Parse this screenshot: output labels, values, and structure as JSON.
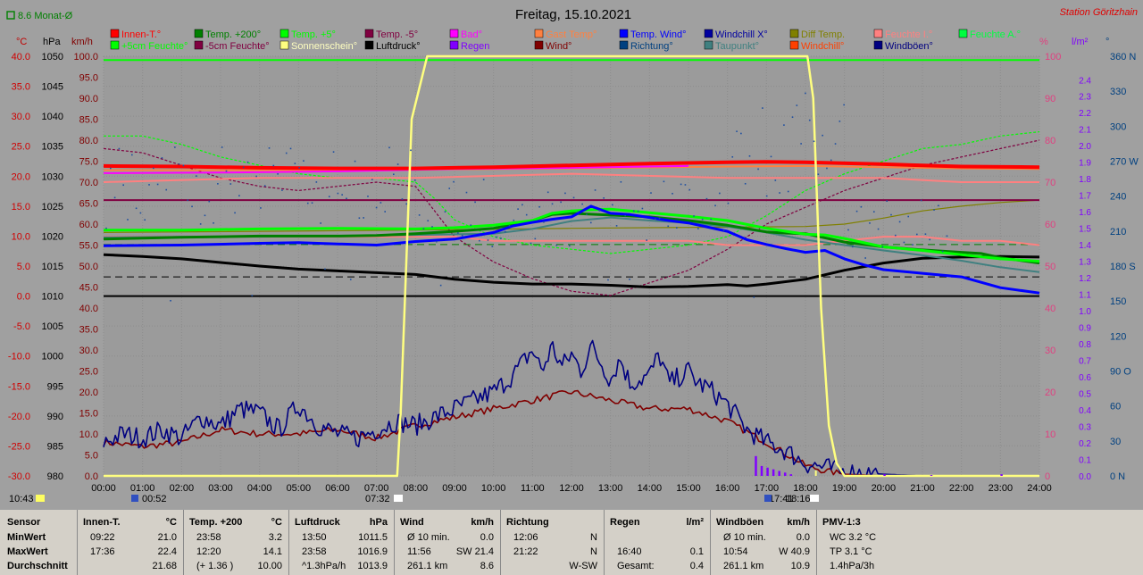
{
  "chart_data": {
    "type": "line",
    "title": "Freitag, 15.10.2021",
    "station": "Station Göritzhain",
    "month_avg_label": "8.6 Monat-Ø",
    "axis_units": {
      "temp": "°C",
      "press": "hPa",
      "kmh": "km/h",
      "pct": "%",
      "rain": "l/m²",
      "dir": "°"
    },
    "x_ticks": [
      "00:00",
      "01:00",
      "02:00",
      "03:00",
      "04:00",
      "05:00",
      "06:00",
      "07:00",
      "08:00",
      "09:00",
      "10:00",
      "11:00",
      "12:00",
      "13:00",
      "14:00",
      "15:00",
      "16:00",
      "17:00",
      "18:00",
      "19:00",
      "20:00",
      "21:00",
      "22:00",
      "23:00",
      "24:00"
    ],
    "temp_ticks": [
      "40.0",
      "35.0",
      "30.0",
      "25.0",
      "20.0",
      "15.0",
      "10.0",
      "5.0",
      "0.0",
      "-5.0",
      "-10.0",
      "-15.0",
      "-20.0",
      "-25.0",
      "-30.0"
    ],
    "press_ticks": [
      "1050",
      "1045",
      "1040",
      "1035",
      "1030",
      "1025",
      "1020",
      "1015",
      "1010",
      "1005",
      "1000",
      "995",
      "990",
      "985",
      "980"
    ],
    "kmh_ticks": [
      "100.0",
      "95.0",
      "90.0",
      "85.0",
      "80.0",
      "75.0",
      "70.0",
      "65.0",
      "60.0",
      "55.0",
      "50.0",
      "45.0",
      "40.0",
      "35.0",
      "30.0",
      "25.0",
      "20.0",
      "15.0",
      "10.0",
      "5.0",
      "0.0"
    ],
    "pct_ticks": [
      "100",
      "90",
      "80",
      "70",
      "60",
      "50",
      "40",
      "30",
      "20",
      "10",
      "0"
    ],
    "rain_ticks": [
      "2.4",
      "2.3",
      "2.2",
      "2.1",
      "2.0",
      "1.9",
      "1.8",
      "1.7",
      "1.6",
      "1.5",
      "1.4",
      "1.3",
      "1.2",
      "1.1",
      "1.0",
      "0.9",
      "0.8",
      "0.7",
      "0.6",
      "0.5",
      "0.4",
      "0.3",
      "0.2",
      "0.1",
      "0.0"
    ],
    "dir_ticks": [
      "360 N",
      "330",
      "300",
      "270 W",
      "240",
      "210",
      "180 S",
      "150",
      "120",
      "90 O",
      "60",
      "30",
      "0 N"
    ],
    "legend": [
      {
        "label": "Innen-T.°",
        "color": "#ff0000"
      },
      {
        "label": "Temp. +200°",
        "color": "#008000"
      },
      {
        "label": "Temp. +5°",
        "color": "#00ff00"
      },
      {
        "label": "Temp. -5°",
        "color": "#800040"
      },
      {
        "label": "Bad°",
        "color": "#ff00ff"
      },
      {
        "label": "Gast Temp°",
        "color": "#ff8040"
      },
      {
        "label": "Temp. Wind°",
        "color": "#0000ff"
      },
      {
        "label": "Windchill X°",
        "color": "#0000a0"
      },
      {
        "label": "Diff Temp.",
        "color": "#808000"
      },
      {
        "label": "Feuchte I.°",
        "color": "#ff8080"
      },
      {
        "label": "Feuchte A.°",
        "color": "#00ff40"
      },
      {
        "label": "+5cm Feuchte°",
        "color": "#00ff00"
      },
      {
        "label": "-5cm Feuchte°",
        "color": "#800040"
      },
      {
        "label": "Sonnenschein°",
        "color": "#ffff80"
      },
      {
        "label": "Luftdruck°",
        "color": "#000000"
      },
      {
        "label": "Regen",
        "color": "#8000ff"
      },
      {
        "label": "Wind°",
        "color": "#800000"
      },
      {
        "label": "Richtung°",
        "color": "#004080"
      },
      {
        "label": "Taupunkt°",
        "color": "#408080"
      },
      {
        "label": "Windchill°",
        "color": "#ff4000"
      },
      {
        "label": "Windböen°",
        "color": "#000080"
      }
    ],
    "markers": {
      "sunrise": "07:32",
      "sunset": "18:16",
      "moonset": "00:52",
      "moonrise": "17:41",
      "now": "10:43"
    },
    "series": [
      {
        "name": "Innen-T.°",
        "color": "#ff0000",
        "axis": "temp",
        "x": [
          0,
          2,
          4,
          6,
          8,
          10,
          12,
          14,
          16,
          17,
          18,
          20,
          22,
          24
        ],
        "y": [
          21.7,
          21.6,
          21.4,
          21.3,
          21.3,
          21.5,
          21.8,
          22.1,
          22.3,
          22.4,
          22.3,
          22.0,
          21.6,
          21.5
        ]
      },
      {
        "name": "Temp. +200°",
        "color": "#008000",
        "axis": "temp",
        "x": [
          0,
          2,
          4,
          6,
          7,
          8,
          9,
          10,
          11,
          11.5,
          12,
          13,
          14,
          15,
          16,
          17,
          17.5,
          18,
          19,
          20,
          21,
          22,
          22.5,
          23,
          24
        ],
        "y": [
          9.5,
          9.8,
          10.0,
          10.0,
          10.1,
          10.4,
          10.8,
          11.3,
          12.6,
          13.6,
          13.8,
          13.5,
          13.2,
          12.6,
          11.8,
          10.7,
          10.5,
          10.4,
          9.0,
          8.2,
          7.7,
          7.3,
          7.1,
          6.4,
          5.5
        ]
      },
      {
        "name": "Temp. +5°",
        "color": "#00ff00",
        "axis": "temp",
        "x": [
          0,
          2,
          4,
          6,
          8,
          9,
          10,
          11,
          11.5,
          12,
          12.5,
          13,
          14,
          15,
          16,
          17,
          18,
          18.5,
          19,
          20,
          21,
          22,
          23,
          24
        ],
        "y": [
          11.0,
          11.0,
          11.2,
          11.3,
          11.2,
          11.4,
          11.8,
          12.6,
          13.8,
          14.2,
          14.4,
          14.5,
          13.9,
          13.3,
          12.6,
          11.3,
          10.3,
          10.2,
          9.6,
          8.2,
          7.6,
          6.9,
          6.2,
          5.8
        ]
      },
      {
        "name": "Temp. Wind°",
        "color": "#0000ff",
        "axis": "temp",
        "x": [
          0,
          2,
          4,
          5,
          6,
          7,
          8,
          9,
          10,
          10.5,
          11,
          11.5,
          12,
          12.5,
          13,
          13.5,
          14,
          14.5,
          15,
          15.5,
          16,
          16.5,
          17,
          17.5,
          18,
          18.5,
          19,
          19.5,
          20,
          21,
          22,
          23,
          24
        ],
        "y": [
          8.4,
          8.5,
          8.8,
          8.9,
          8.7,
          8.5,
          9.1,
          9.5,
          10.6,
          11.7,
          12.3,
          12.8,
          13.2,
          15.0,
          13.8,
          13.6,
          13.1,
          12.6,
          12.2,
          11.5,
          10.8,
          9.4,
          8.6,
          7.9,
          7.3,
          7.6,
          6.2,
          5.2,
          4.4,
          3.8,
          3.2,
          1.4,
          0.5
        ]
      },
      {
        "name": "Taupunkt°",
        "color": "#408080",
        "axis": "temp",
        "x": [
          0,
          2,
          4,
          6,
          8,
          10,
          11,
          12,
          13,
          14,
          15,
          16,
          17,
          18,
          19,
          20,
          21,
          22,
          23,
          24
        ],
        "y": [
          9.8,
          9.9,
          9.9,
          10.0,
          10.2,
          10.4,
          11.2,
          12.5,
          13.1,
          12.6,
          12.2,
          11.6,
          10.6,
          9.4,
          8.5,
          7.6,
          6.8,
          5.9,
          4.8,
          4.0
        ]
      },
      {
        "name": "Diff Temp.",
        "color": "#808000",
        "axis": "temp",
        "x": [
          0,
          4,
          8,
          12,
          16,
          18,
          19,
          20,
          21,
          22,
          23,
          24
        ],
        "y": [
          10.6,
          10.8,
          11.0,
          11.3,
          11.5,
          11.6,
          12.0,
          13.0,
          14.2,
          15.0,
          15.6,
          16.0
        ]
      },
      {
        "name": "Feuchte I.°",
        "color": "#ff8080",
        "axis": "pct",
        "x": [
          0,
          4,
          8,
          12,
          16,
          18,
          20,
          22,
          24
        ],
        "y": [
          70,
          71,
          71,
          72,
          71,
          71,
          71,
          70,
          70
        ]
      },
      {
        "name": "Feuchte A.°",
        "color": "#ff8080",
        "axis": "pct",
        "x": [
          0,
          3,
          6,
          8,
          9,
          10,
          11,
          12,
          13,
          14,
          15,
          16,
          17,
          18,
          19,
          20,
          21,
          22,
          23,
          24
        ],
        "y": [
          57,
          57,
          57,
          57,
          57,
          56,
          56,
          56,
          56,
          56,
          56,
          55,
          55,
          55,
          56,
          57,
          57,
          56,
          56,
          55
        ]
      },
      {
        "name": "Gast Temp°",
        "color": "#ff8040",
        "axis": "temp",
        "x": [
          0,
          4,
          8,
          12,
          16,
          18,
          20,
          22,
          24
        ],
        "y": [
          21.0,
          21.0,
          21.1,
          21.3,
          21.6,
          21.7,
          21.5,
          21.3,
          21.2
        ]
      },
      {
        "name": "Bad°",
        "color": "#ff00ff",
        "axis": "temp",
        "x": [
          0,
          3,
          6,
          9,
          12,
          14,
          15
        ],
        "y": [
          20.5,
          20.6,
          20.8,
          21.2,
          21.4,
          21.6,
          21.7
        ]
      },
      {
        "name": "Temp. -5°",
        "color": "#800040",
        "axis": "temp",
        "x": [
          0,
          24
        ],
        "y": [
          16.0,
          16.0
        ]
      },
      {
        "name": "+5cm Feuchte°",
        "color": "#00ff00",
        "axis": "pct",
        "dash": true,
        "x": [
          0,
          1,
          2,
          3,
          4,
          5,
          6,
          7,
          8,
          8.5,
          9,
          10,
          11,
          12,
          13,
          14,
          15,
          16,
          17,
          18,
          19,
          20,
          21,
          22,
          23,
          24
        ],
        "y": [
          81,
          81,
          79,
          76,
          74,
          72,
          71,
          71,
          70,
          66,
          61,
          57,
          55,
          54,
          53,
          54,
          55,
          57,
          62,
          68,
          72,
          75,
          78,
          79,
          81,
          82
        ]
      },
      {
        "name": "-5cm Feuchte°",
        "color": "#800040",
        "axis": "pct",
        "dash": true,
        "x": [
          0,
          1,
          2,
          3,
          4,
          5,
          6,
          7,
          8,
          8.5,
          9,
          10,
          11,
          12,
          13,
          14,
          15,
          16,
          17,
          18,
          19,
          20,
          21,
          22,
          23,
          24
        ],
        "y": [
          78,
          77,
          74,
          71,
          69,
          68,
          69,
          70,
          69,
          63,
          57,
          51,
          47,
          44,
          43,
          46,
          49,
          54,
          60,
          64,
          68,
          71,
          74,
          76,
          78,
          80
        ]
      },
      {
        "name": "Luftdruck°",
        "color": "#000000",
        "axis": "press",
        "x": [
          0,
          1,
          2,
          3,
          4,
          5,
          6,
          7,
          8,
          9,
          10,
          11,
          12,
          13,
          14,
          15,
          16,
          16.5,
          17,
          18,
          19,
          20,
          21,
          22,
          23,
          24
        ],
        "y": [
          1016.9,
          1016.6,
          1016.2,
          1015.6,
          1015.0,
          1014.5,
          1014.2,
          1013.9,
          1013.6,
          1012.8,
          1012.3,
          1012.0,
          1012.0,
          1011.8,
          1011.5,
          1011.6,
          1011.9,
          1011.7,
          1012.0,
          1012.8,
          1014.3,
          1015.5,
          1016.3,
          1016.5,
          1016.6,
          1016.5
        ]
      },
      {
        "name": "Windböen°",
        "color": "#000080",
        "axis": "kmh",
        "x": [
          0,
          0.5,
          1,
          1.5,
          2,
          2.5,
          3,
          3.5,
          4,
          4.5,
          5,
          5.5,
          6,
          6.5,
          7,
          7.5,
          8,
          8.5,
          9,
          9.5,
          10,
          10.5,
          11,
          11.25,
          11.5,
          11.75,
          12,
          12.25,
          12.5,
          13,
          13.25,
          13.5,
          14,
          14.25,
          14.5,
          15,
          15.25,
          15.5,
          16,
          16.5,
          17,
          17.5,
          18,
          18.5,
          19,
          20,
          21,
          22,
          23,
          24
        ],
        "y": [
          8,
          10,
          9,
          11,
          9,
          14,
          12,
          16,
          15,
          11,
          17,
          12,
          10,
          9,
          11,
          13,
          12,
          14,
          16,
          18,
          20,
          24,
          30,
          25,
          31,
          26,
          29,
          25,
          31,
          23,
          28,
          22,
          24,
          29,
          22,
          25,
          22,
          21,
          17,
          11,
          8,
          6,
          3,
          2,
          1,
          0.4,
          0,
          0,
          0,
          0
        ]
      },
      {
        "name": "Wind°",
        "color": "#800000",
        "axis": "kmh",
        "x": [
          0,
          1,
          2,
          3,
          4,
          5,
          6,
          7,
          8,
          9,
          10,
          11,
          12,
          13,
          14,
          15,
          16,
          17,
          18,
          18.5,
          19,
          20,
          21,
          22,
          23,
          24
        ],
        "y": [
          8,
          7,
          8,
          11,
          10,
          10,
          11,
          9,
          12,
          14,
          16,
          18,
          20,
          18,
          16,
          16,
          13,
          8,
          2.5,
          1.2,
          0.4,
          0,
          0,
          0,
          0,
          0
        ]
      },
      {
        "name": "Sonnenschein°",
        "color": "#ffff80",
        "axis": "pct",
        "x": [
          0,
          7.53,
          7.62,
          7.9,
          8.3,
          8.7,
          18.05,
          18.2,
          18.4,
          18.6,
          18.8,
          19,
          24
        ],
        "y": [
          0,
          0,
          15,
          85,
          100,
          100,
          100,
          90,
          40,
          12,
          3,
          0,
          0
        ]
      },
      {
        "name": "Regen",
        "color": "#8000ff",
        "axis": "rain",
        "x": [
          16.7,
          16.85,
          17.0,
          17.15,
          17.3,
          17.45,
          17.6,
          20.0,
          21.2,
          23.0
        ],
        "y": [
          0.12,
          0.06,
          0.05,
          0.04,
          0.03,
          0.02,
          0.01,
          0.01,
          0.005,
          0.01
        ]
      }
    ],
    "reference_lines": [
      {
        "color": "#00ff00",
        "axis": "kmh",
        "value": 99.1
      },
      {
        "color": "#000000",
        "axis": "temp",
        "value": 0
      },
      {
        "color": "#000000",
        "axis": "temp",
        "value": 3.2,
        "dash": true
      },
      {
        "color": "#008000",
        "axis": "temp",
        "value": 8.6,
        "dash": true
      }
    ]
  },
  "table": {
    "row_labels": [
      "Sensor",
      "MinWert",
      "MaxWert",
      "Durchschnitt"
    ],
    "sections": [
      {
        "title": "Innen-T.",
        "unit": "°C",
        "min_time": "09:22",
        "min": "21.0",
        "max_time": "17:36",
        "max": "22.4",
        "avg_time": "",
        "avg": "21.68"
      },
      {
        "title": "Temp. +200",
        "unit": "°C",
        "min_time": "23:58",
        "min": "3.2",
        "max_time": "12:20",
        "max": "14.1",
        "avg_time": "(+ 1.36 )",
        "avg": "10.00"
      },
      {
        "title": "Luftdruck",
        "unit": "hPa",
        "min_time": "13:50",
        "min": "1011.5",
        "max_time": "23:58",
        "max": "1016.9",
        "avg_time": "^1.3hPa/h",
        "avg": "1013.9"
      },
      {
        "title": "Wind",
        "unit": "km/h",
        "min_time": "Ø 10 min.",
        "min": "0.0",
        "max_time": "11:56",
        "max": "SW 21.4",
        "avg_time": "261.1 km",
        "avg": "8.6"
      },
      {
        "title": "Richtung",
        "unit": "",
        "min_time": "12:06",
        "min": "N",
        "max_time": "21:22",
        "max": "N",
        "avg_time": "",
        "avg": "W-SW"
      },
      {
        "title": "Regen",
        "unit": "l/m²",
        "min_time": "",
        "min": "",
        "max_time": "16:40",
        "max": "0.1",
        "avg_time": "Gesamt:",
        "avg": "0.4"
      },
      {
        "title": "Windböen",
        "unit": "km/h",
        "min_time": "Ø 10 min.",
        "min": "0.0",
        "max_time": "10:54",
        "max": "W 40.9",
        "avg_time": "261.1 km",
        "avg": "10.9"
      },
      {
        "title": "PMV-1:3",
        "unit": "",
        "min_time": "WC 3.2 °C",
        "min": "",
        "max_time": "TP 3.1 °C",
        "max": "",
        "avg_time": "1.4hPa/3h",
        "avg": ""
      }
    ]
  }
}
